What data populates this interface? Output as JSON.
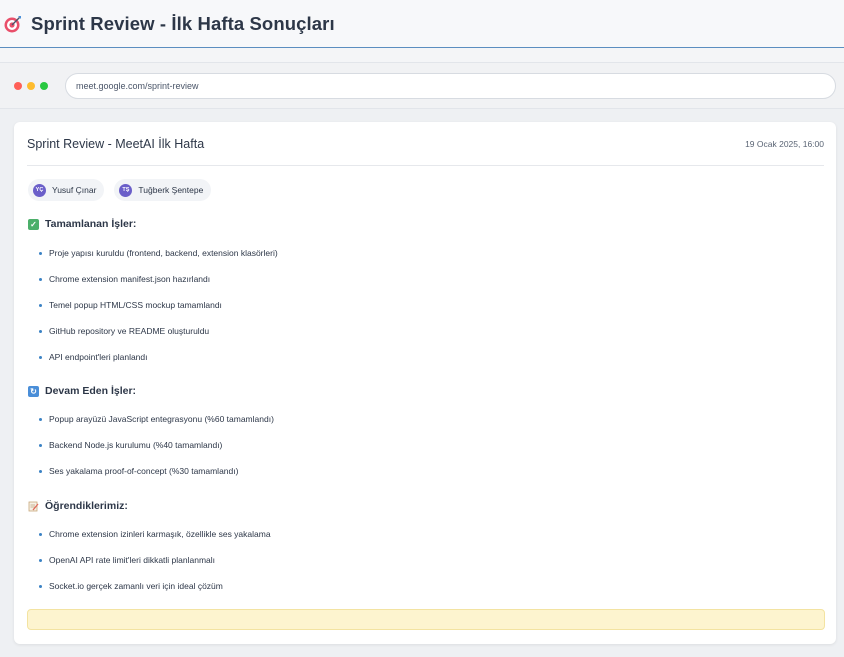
{
  "page": {
    "title": "Sprint Review - İlk Hafta Sonuçları",
    "title_icon": "target-icon"
  },
  "browser": {
    "url": "meet.google.com/sprint-review",
    "traffic_lights": [
      "#ff5f57",
      "#febc2e",
      "#28c840"
    ]
  },
  "meeting": {
    "title": "Sprint Review - MeetAI İlk Hafta",
    "date": "19 Ocak 2025, 16:00",
    "participants": [
      {
        "initials": "YÇ",
        "name": "Yusuf Çınar"
      },
      {
        "initials": "TŞ",
        "name": "Tuğberk Şentepe"
      }
    ]
  },
  "sections": {
    "completed": {
      "title": "Tamamlanan İşler:",
      "icon": "check-box-icon",
      "items": [
        "Proje yapısı kuruldu (frontend, backend, extension klasörleri)",
        "Chrome extension manifest.json hazırlandı",
        "Temel popup HTML/CSS mockup tamamlandı",
        "GitHub repository ve README oluşturuldu",
        "API endpoint'leri planlandı"
      ]
    },
    "in_progress": {
      "title": "Devam Eden İşler:",
      "icon": "refresh-icon",
      "items": [
        "Popup arayüzü JavaScript entegrasyonu (%60 tamamlandı)",
        "Backend Node.js kurulumu (%40 tamamlandı)",
        "Ses yakalama proof-of-concept (%30 tamamlandı)"
      ]
    },
    "learned": {
      "title": "Öğrendiklerimiz:",
      "icon": "memo-icon",
      "items": [
        "Chrome extension izinleri karmaşık, özellikle ses yakalama",
        "OpenAI API rate limit'leri dikkatli planlanmalı",
        "Socket.io gerçek zamanlı veri için ideal çözüm"
      ]
    }
  },
  "colors": {
    "accent": "#3b82c4",
    "avatar": "#6b5fc9",
    "note_bg": "#fdf4cf"
  }
}
